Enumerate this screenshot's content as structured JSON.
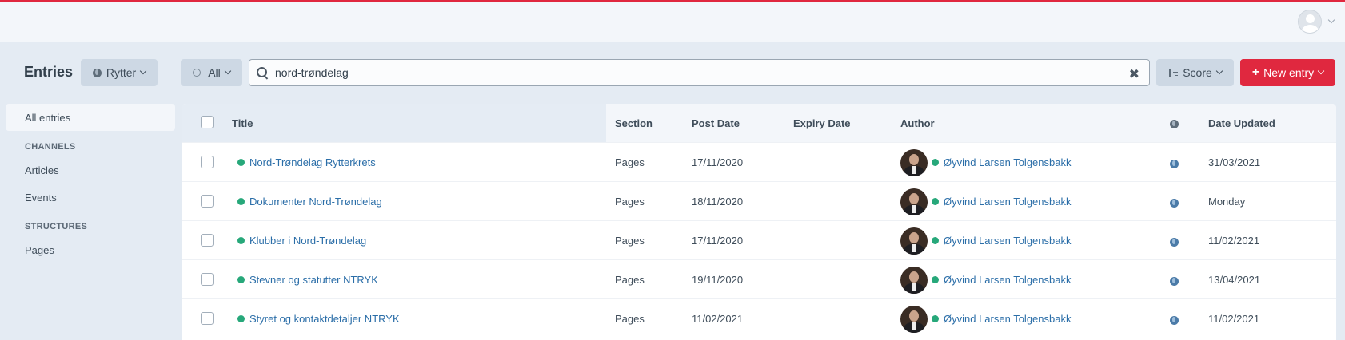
{
  "header": {
    "user_menu_icon": "user-avatar-icon"
  },
  "toolbar": {
    "page_title": "Entries",
    "site_label": "Rytter",
    "status_label": "All",
    "search_value": "nord-trøndelag",
    "sort_label": "Score",
    "new_entry_label": "New entry"
  },
  "sidebar": {
    "all_entries": "All entries",
    "channels_heading": "CHANNELS",
    "channels": [
      "Articles",
      "Events"
    ],
    "structures_heading": "STRUCTURES",
    "structures": [
      "Pages"
    ]
  },
  "table": {
    "columns": {
      "title": "Title",
      "section": "Section",
      "post_date": "Post Date",
      "expiry_date": "Expiry Date",
      "author": "Author",
      "date_updated": "Date Updated"
    },
    "rows": [
      {
        "title": "Nord-Trøndelag Rytterkrets",
        "section": "Pages",
        "post_date": "17/11/2020",
        "expiry_date": "",
        "author": "Øyvind Larsen Tolgensbakk",
        "date_updated": "31/03/2021"
      },
      {
        "title": "Dokumenter Nord-Trøndelag",
        "section": "Pages",
        "post_date": "18/11/2020",
        "expiry_date": "",
        "author": "Øyvind Larsen Tolgensbakk",
        "date_updated": "Monday"
      },
      {
        "title": "Klubber i Nord-Trøndelag",
        "section": "Pages",
        "post_date": "17/11/2020",
        "expiry_date": "",
        "author": "Øyvind Larsen Tolgensbakk",
        "date_updated": "11/02/2021"
      },
      {
        "title": "Stevner og statutter NTRYK",
        "section": "Pages",
        "post_date": "19/11/2020",
        "expiry_date": "",
        "author": "Øyvind Larsen Tolgensbakk",
        "date_updated": "13/04/2021"
      },
      {
        "title": "Styret og kontaktdetaljer NTRYK",
        "section": "Pages",
        "post_date": "11/02/2021",
        "expiry_date": "",
        "author": "Øyvind Larsen Tolgensbakk",
        "date_updated": "11/02/2021"
      }
    ]
  },
  "colors": {
    "accent": "#e0283f",
    "status_enabled": "#27a87a",
    "link": "#2b6ea8"
  }
}
